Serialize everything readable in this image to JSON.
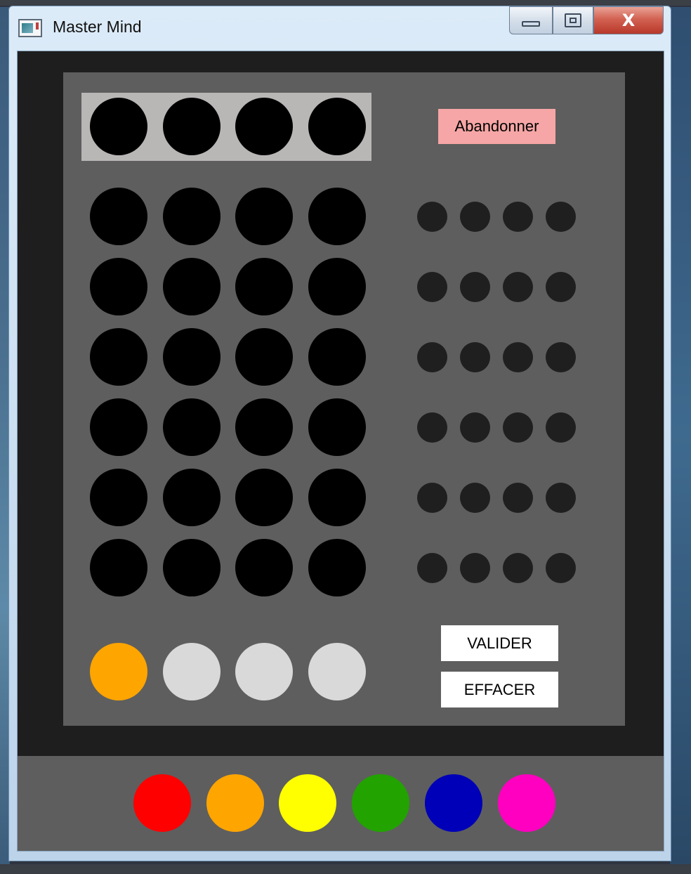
{
  "window": {
    "title": "Master Mind",
    "buttons": {
      "close_glyph": "X"
    }
  },
  "board": {
    "abandon_label": "Abandonner",
    "validate_label": "VALIDER",
    "clear_label": "EFFACER",
    "secret_code": [
      "#000000",
      "#000000",
      "#000000",
      "#000000"
    ],
    "guess_rows": [
      {
        "pegs": [
          "#000000",
          "#000000",
          "#000000",
          "#000000"
        ],
        "hints": [
          "#1f1f1f",
          "#1f1f1f",
          "#1f1f1f",
          "#1f1f1f"
        ]
      },
      {
        "pegs": [
          "#000000",
          "#000000",
          "#000000",
          "#000000"
        ],
        "hints": [
          "#1f1f1f",
          "#1f1f1f",
          "#1f1f1f",
          "#1f1f1f"
        ]
      },
      {
        "pegs": [
          "#000000",
          "#000000",
          "#000000",
          "#000000"
        ],
        "hints": [
          "#1f1f1f",
          "#1f1f1f",
          "#1f1f1f",
          "#1f1f1f"
        ]
      },
      {
        "pegs": [
          "#000000",
          "#000000",
          "#000000",
          "#000000"
        ],
        "hints": [
          "#1f1f1f",
          "#1f1f1f",
          "#1f1f1f",
          "#1f1f1f"
        ]
      },
      {
        "pegs": [
          "#000000",
          "#000000",
          "#000000",
          "#000000"
        ],
        "hints": [
          "#1f1f1f",
          "#1f1f1f",
          "#1f1f1f",
          "#1f1f1f"
        ]
      },
      {
        "pegs": [
          "#000000",
          "#000000",
          "#000000",
          "#000000"
        ],
        "hints": [
          "#1f1f1f",
          "#1f1f1f",
          "#1f1f1f",
          "#1f1f1f"
        ]
      }
    ],
    "current_guess": [
      "#ffa500",
      "#d9d9d9",
      "#d9d9d9",
      "#d9d9d9"
    ]
  },
  "palette": {
    "colors": [
      {
        "name": "red",
        "hex": "#ff0000"
      },
      {
        "name": "orange",
        "hex": "#ffa500"
      },
      {
        "name": "yellow",
        "hex": "#ffff00"
      },
      {
        "name": "green",
        "hex": "#22a300"
      },
      {
        "name": "blue",
        "hex": "#0000b8"
      },
      {
        "name": "magenta",
        "hex": "#ff00c0"
      }
    ]
  }
}
